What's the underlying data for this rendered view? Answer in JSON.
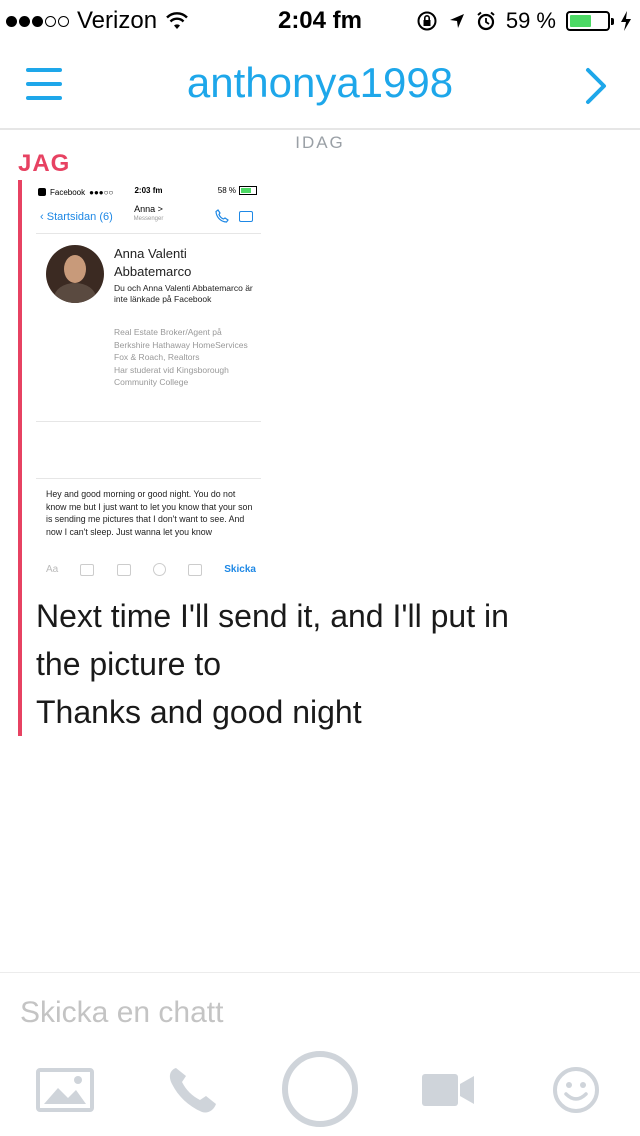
{
  "status_bar": {
    "carrier": "Verizon",
    "time": "2:04 fm",
    "battery_percent": "59 %",
    "battery_level": 0.59
  },
  "header": {
    "title": "anthonya1998"
  },
  "conversation": {
    "day_label": "IDAG",
    "sender": "JAG",
    "message_lines": [
      "Next time I'll send it, and I'll put in",
      "the picture to",
      "Thanks and good night"
    ]
  },
  "screenshot": {
    "app_label": "Facebook",
    "time": "2:03 fm",
    "battery": "58 %",
    "back_label": "Startsidan (6)",
    "contact_short": "Anna >",
    "contact_sub": "Messenger",
    "profile_name": "Anna Valenti Abbatemarco",
    "profile_note": "Du och Anna Valenti Abbatemarco är inte länkade på Facebook",
    "profile_work": "Real Estate Broker/Agent på Berkshire Hathaway HomeServices Fox & Roach, Realtors",
    "profile_school": "Har studerat vid Kingsborough Community College",
    "draft_message": "Hey and good morning or good night. You do not know me but I just want to let you know that your son is sending me pictures that I don't want to see. And now I can't sleep. Just wanna let you know",
    "toolbar_aa": "Aa",
    "send_label": "Skicka"
  },
  "composer": {
    "placeholder": "Skicka en chatt"
  },
  "colors": {
    "accent": "#1ea7ea",
    "sender": "#e74262",
    "icon_gray": "#cfd4da"
  }
}
